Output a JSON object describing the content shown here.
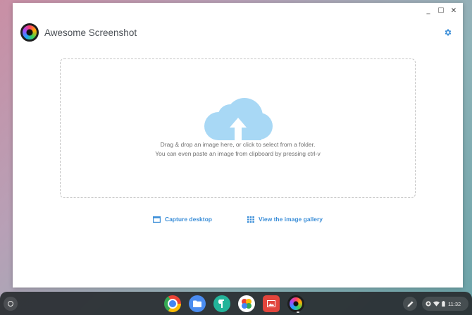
{
  "window": {
    "controls": {
      "minimize": "_",
      "maximize": "☐",
      "close": "✕"
    }
  },
  "app": {
    "title": "Awesome Screenshot"
  },
  "dropzone": {
    "line1": "Drag & drop an image here, or click to select from a folder.",
    "line2": "You can even paste an image from clipboard by pressing ctrl-v"
  },
  "actions": {
    "capture_desktop": "Capture desktop",
    "view_gallery": "View the image gallery"
  },
  "colors": {
    "accent": "#3b8ed8",
    "cloud": "#a8d8f5"
  },
  "shelf": {
    "apps": [
      "chrome-icon",
      "files-icon",
      "keep-icon",
      "photos-icon",
      "gallery-icon",
      "awesome-screenshot-icon"
    ],
    "clock": "11:32"
  }
}
